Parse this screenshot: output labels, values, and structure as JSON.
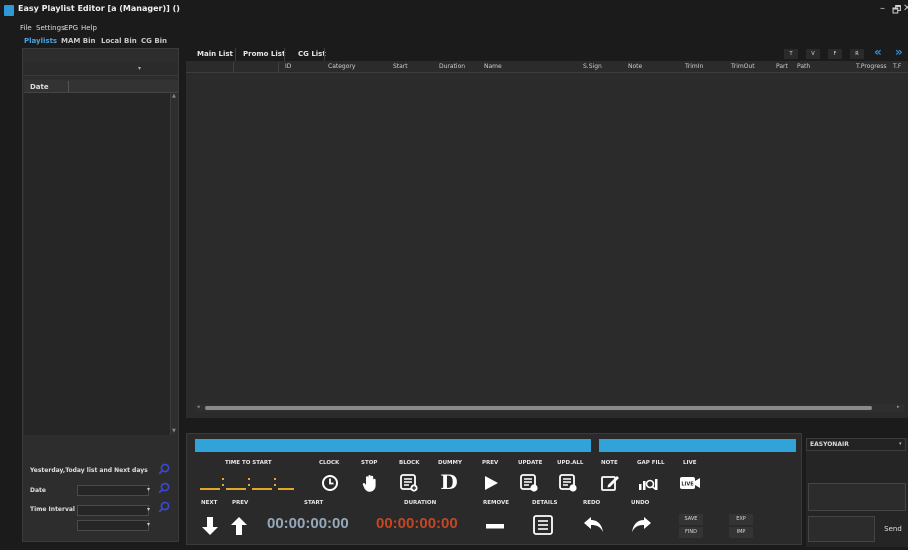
{
  "window": {
    "title": "Easy Playlist Editor [a (Manager)] ()",
    "minimize": "–",
    "restore": "🗗",
    "close": "✕"
  },
  "menu": [
    "File",
    "Settings",
    "EPG",
    "Help"
  ],
  "left": {
    "tabs": [
      "Playlists",
      "MAM Bin",
      "Local Bin",
      "CG Bin"
    ],
    "active_tab": "Playlists",
    "filter_value": "",
    "date_header": "Date",
    "preset_label": "Yesterday,Today list and Next days",
    "date_label": "Date",
    "date_value": "",
    "time_interval_label": "Time Interval",
    "time_from": "",
    "time_to": ""
  },
  "main": {
    "tabs": [
      "Main List",
      "Promo List",
      "CG List"
    ],
    "view_buttons": [
      "T",
      "V",
      "F",
      "R"
    ],
    "columns": [
      "ID",
      "Category",
      "Start",
      "Duration",
      "Name",
      "S.Sign",
      "Note",
      "TrimIn",
      "TrimOut",
      "Part",
      "Path",
      "T.Progress",
      "T.F"
    ]
  },
  "controls": {
    "time_to_start_label": "TIME TO START",
    "row1_labels": [
      "CLOCK",
      "STOP",
      "BLOCK",
      "DUMMY",
      "PREV",
      "UPDATE",
      "UPD.ALL",
      "NOTE",
      "GAP FILL",
      "LIVE"
    ],
    "next_label": "NEXT",
    "prev_label": "PREV",
    "start_label": "START",
    "duration_label": "DURATION",
    "remove_label": "REMOVE",
    "details_label": "DETAILS",
    "redo_label": "REDO",
    "undo_label": "UNDO",
    "start_time": "00:00:00:00",
    "duration_time": "00:00:00:00",
    "save": "SAVE",
    "find": "FIND",
    "exp": "EXP",
    "imp": "IMP",
    "dummy_glyph": "D",
    "live_glyph": "LIVE"
  },
  "right": {
    "source_select": "EASYONAIR",
    "send": "Send"
  },
  "colors": {
    "accent_blue": "#31a3d8",
    "duration_red": "#c24724",
    "start_blue": "#97a8ba",
    "tab_active": "#4aa3df"
  }
}
